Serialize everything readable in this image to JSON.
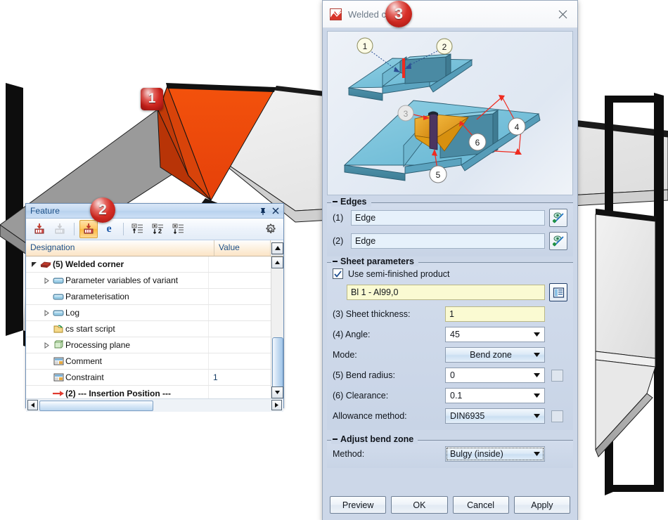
{
  "viewport": {
    "name": "3d-model-viewport",
    "badges": [
      {
        "id": "badge-1",
        "label": "1",
        "shape": "square"
      },
      {
        "id": "badge-2",
        "label": "2",
        "shape": "circle"
      },
      {
        "id": "badge-3",
        "label": "3",
        "shape": "circle"
      }
    ]
  },
  "feature_panel": {
    "title": "Feature",
    "pin_icon": "pin-icon",
    "close_icon": "close-icon",
    "toolbar": [
      {
        "name": "import-feature-icon",
        "label": "Import feature"
      },
      {
        "name": "export-feature-icon",
        "label": "Export feature"
      },
      {
        "name": "edit-feature-icon",
        "label": "Edit feature"
      },
      {
        "name": "expression-icon",
        "label": "e"
      },
      {
        "name": "collapse-all-icon",
        "label": "Collapse all"
      },
      {
        "name": "expand-level-2-icon",
        "label": "Expand level 2"
      },
      {
        "name": "expand-all-icon",
        "label": "Expand all"
      },
      {
        "name": "settings-gear-icon",
        "label": "Settings"
      }
    ],
    "columns": [
      "Designation",
      "Value"
    ],
    "rows": [
      {
        "icon": "welded-corner-icon",
        "label": "(5) Welded corner",
        "value": "",
        "bold": true,
        "indent": 0,
        "twisty": "expanded"
      },
      {
        "icon": "folder-blue-icon",
        "label": "Parameter variables of variant",
        "value": "",
        "bold": false,
        "indent": 1,
        "twisty": "collapsed"
      },
      {
        "icon": "folder-blue-icon",
        "label": "Parameterisation",
        "value": "",
        "bold": false,
        "indent": 1,
        "twisty": "none"
      },
      {
        "icon": "folder-blue-icon",
        "label": "Log",
        "value": "",
        "bold": false,
        "indent": 1,
        "twisty": "collapsed"
      },
      {
        "icon": "script-icon",
        "label": "cs start script",
        "value": "",
        "bold": false,
        "indent": 1,
        "twisty": "none"
      },
      {
        "icon": "processing-plane-icon",
        "label": "Processing plane",
        "value": "",
        "bold": false,
        "indent": 1,
        "twisty": "collapsed"
      },
      {
        "icon": "comment-icon",
        "label": "Comment",
        "value": "",
        "bold": false,
        "indent": 1,
        "twisty": "none"
      },
      {
        "icon": "constraint-icon",
        "label": "Constraint",
        "value": "1",
        "bold": false,
        "indent": 1,
        "twisty": "none"
      },
      {
        "icon": "insertion-arrow-icon",
        "label": "(2) --- Insertion Position ---",
        "value": "",
        "bold": true,
        "indent": 0,
        "twisty": "none"
      }
    ]
  },
  "dialog": {
    "title": "Welded corner",
    "app_icon": "welded-corner-app-icon",
    "close_icon": "close-icon",
    "preview": {
      "name": "welded-corner-preview-illustration",
      "callouts": [
        "1",
        "2",
        "3",
        "4",
        "5",
        "6"
      ]
    },
    "edges_group": {
      "legend": "Edges",
      "fields": [
        {
          "num": "(1)",
          "value": "Edge",
          "picker": "pick-edge-icon"
        },
        {
          "num": "(2)",
          "value": "Edge",
          "picker": "pick-edge-icon"
        }
      ]
    },
    "sheet_group": {
      "legend": "Sheet parameters",
      "checkbox_label": "Use semi-finished product",
      "checkbox_checked": true,
      "semi_finished_value": "Bl 1 - Al99,0",
      "semi_finished_button": "select-material-icon",
      "fields": [
        {
          "label": "(3) Sheet thickness:",
          "value": "1",
          "kind": "text-yellow",
          "extra": false
        },
        {
          "label": "(4) Angle:",
          "value": "45",
          "kind": "combo-white",
          "extra": false
        },
        {
          "label": "Mode:",
          "value": "Bend zone",
          "kind": "combo-blue",
          "extra": false
        },
        {
          "label": "(5) Bend radius:",
          "value": "0",
          "kind": "combo-white",
          "extra": true
        },
        {
          "label": "(6) Clearance:",
          "value": "0.1",
          "kind": "combo-white",
          "extra": false
        },
        {
          "label": "Allowance method:",
          "value": "DIN6935",
          "kind": "combo-blue",
          "extra": true
        }
      ]
    },
    "bend_zone_group": {
      "legend": "Adjust bend zone",
      "method_label": "Method:",
      "method_value": "Bulgy (inside)"
    },
    "buttons": [
      {
        "name": "preview-button",
        "label": "Preview"
      },
      {
        "name": "ok-button",
        "label": "OK"
      },
      {
        "name": "cancel-button",
        "label": "Cancel"
      },
      {
        "name": "apply-button",
        "label": "Apply"
      }
    ]
  },
  "colors": {
    "badge_red": "#d02a22",
    "highlight_orange": "#f2500a",
    "dialog_bg": "#ccd7e8",
    "field_blue": "#e6f1fb",
    "field_yellow": "#fafad2",
    "panel_title_blue": "#1c4f87"
  }
}
